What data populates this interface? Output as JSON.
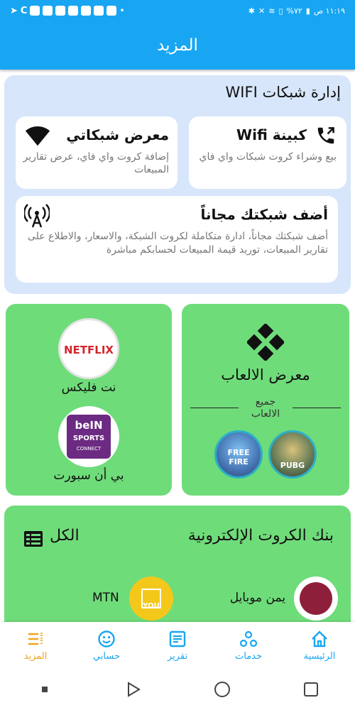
{
  "status_bar": {
    "time": "١١:١٩ ص",
    "battery": "%٧٢"
  },
  "header": {
    "title": "المزيد"
  },
  "wifi_section": {
    "heading": "إدارة شبكات WIFI",
    "cabinet": {
      "title": "كبينة Wifi",
      "description": "بيع وشراء كروت شبكات واي فاي"
    },
    "gallery": {
      "title": "معرض شبكاتي",
      "description": "إضافة كروت واي فاي، عرض تقارير المبيعات"
    },
    "add_network": {
      "title": "أضف شبكتك مجاناً",
      "description": "أضف شبكتك مجاناً، ادارة متكاملة لكروت الشبكة، والاسعار، والاطلاع على تقارير المبيعات، توريد قيمة المبيعات لحسابكم مباشرة"
    }
  },
  "games": {
    "title": "معرض الالعاب",
    "all_label_line1": "جميع",
    "all_label_line2": "الالعاب",
    "items": [
      {
        "name": "PUBG",
        "icon": "pubg-logo"
      },
      {
        "name": "FREE FIRE",
        "icon": "freefire-logo"
      }
    ]
  },
  "streaming": {
    "netflix": {
      "label": "نت فليكس",
      "logo_text": "NETFLIX"
    },
    "bein": {
      "label": "بي أن سبورت",
      "logo_line1": "beIN",
      "logo_line2": "SPORTS",
      "logo_line3": "CONNECT"
    }
  },
  "cards_bank": {
    "title": "بنك الكروت الإلكترونية",
    "all_label": "الكل",
    "operators": [
      {
        "name": "يمن موبايل"
      },
      {
        "name": "MTN",
        "logo_text": "YOU"
      }
    ]
  },
  "bottom_nav": {
    "items": [
      {
        "label": "الرئيسية",
        "icon": "home-icon"
      },
      {
        "label": "خدمات",
        "icon": "services-icon"
      },
      {
        "label": "تقرير",
        "icon": "report-icon"
      },
      {
        "label": "حسابي",
        "icon": "account-icon"
      },
      {
        "label": "المزيد",
        "icon": "more-icon",
        "active": true
      }
    ]
  },
  "colors": {
    "primary": "#18a6f2",
    "card_blue": "#d7e6fa",
    "card_green": "#6fdc7a",
    "active_tab": "#f2a31b"
  }
}
